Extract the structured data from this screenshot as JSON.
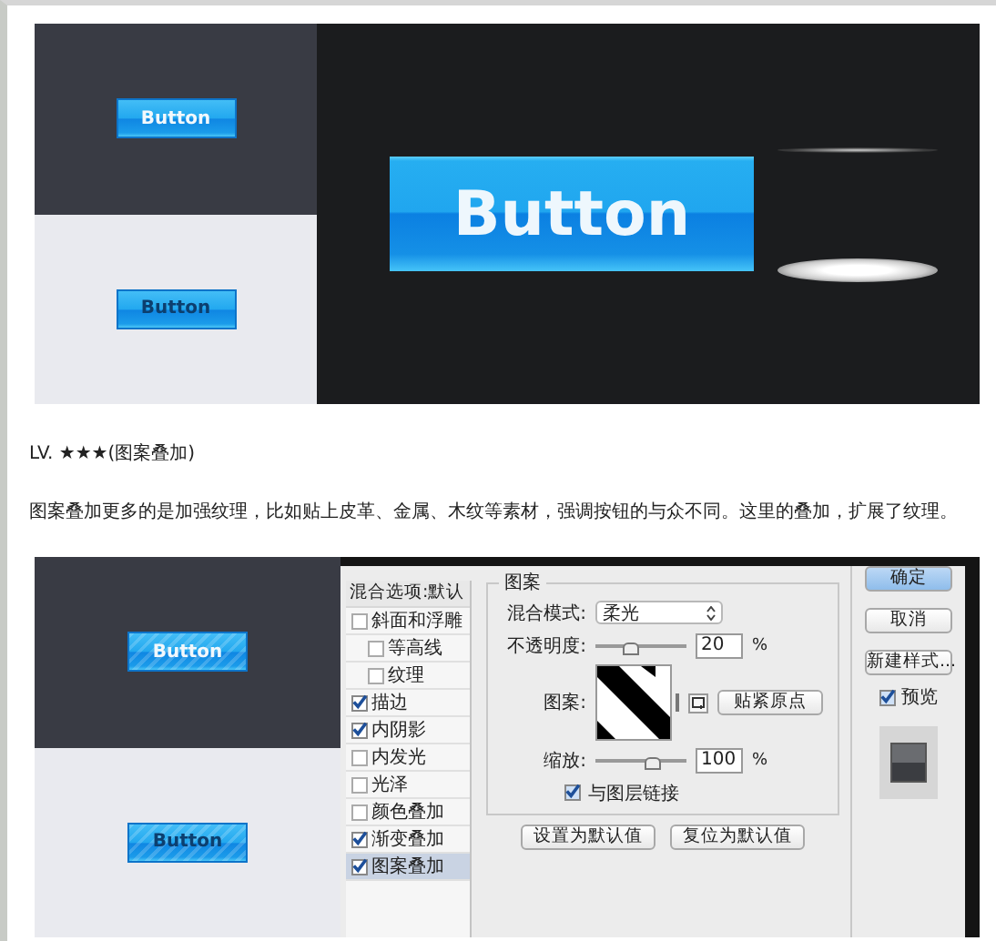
{
  "figure_1": {
    "small_buttons": [
      {
        "label": "Button",
        "kind": "on-dark"
      },
      {
        "label": "Button",
        "kind": "on-light"
      }
    ],
    "large_button": {
      "label": "Button"
    }
  },
  "heading": "LV. ★★★(图案叠加)",
  "paragraph": "图案叠加更多的是加强纹理，比如贴上皮革、金属、木纹等素材，强调按钮的与众不同。这里的叠加，扩展了纹理。",
  "figure_2": {
    "small_buttons": [
      {
        "label": "Button",
        "kind": "on-dark"
      },
      {
        "label": "Button",
        "kind": "on-light"
      }
    ],
    "layer_style_dialog": {
      "sidebar": {
        "header": "混合选项:默认",
        "items": [
          {
            "label": "斜面和浮雕",
            "checked": false,
            "selected": false,
            "children": [
              {
                "label": "等高线",
                "checked": false,
                "selected": false
              },
              {
                "label": "纹理",
                "checked": false,
                "selected": false
              }
            ]
          },
          {
            "label": "描边",
            "checked": true,
            "selected": false
          },
          {
            "label": "内阴影",
            "checked": true,
            "selected": false
          },
          {
            "label": "内发光",
            "checked": false,
            "selected": false
          },
          {
            "label": "光泽",
            "checked": false,
            "selected": false
          },
          {
            "label": "颜色叠加",
            "checked": false,
            "selected": false
          },
          {
            "label": "渐变叠加",
            "checked": true,
            "selected": false
          },
          {
            "label": "图案叠加",
            "checked": true,
            "selected": true
          }
        ]
      },
      "pattern_group": {
        "title": "图案",
        "blend_mode": {
          "label": "混合模式:",
          "value": "柔光"
        },
        "opacity": {
          "label": "不透明度:",
          "level": 0.35,
          "value": "20",
          "unit": "%"
        },
        "pattern": {
          "label": "图案:",
          "snap_button": "贴紧原点"
        },
        "scale": {
          "label": "缩放:",
          "level": 0.6,
          "value": "100",
          "unit": "%"
        },
        "link": {
          "label": "与图层链接",
          "checked": true
        }
      },
      "group_buttons": [
        "设置为默认值",
        "复位为默认值"
      ],
      "side_buttons": [
        "确定",
        "取消",
        "新建样式..."
      ],
      "preview": {
        "label": "预览",
        "checked": true
      }
    }
  }
}
